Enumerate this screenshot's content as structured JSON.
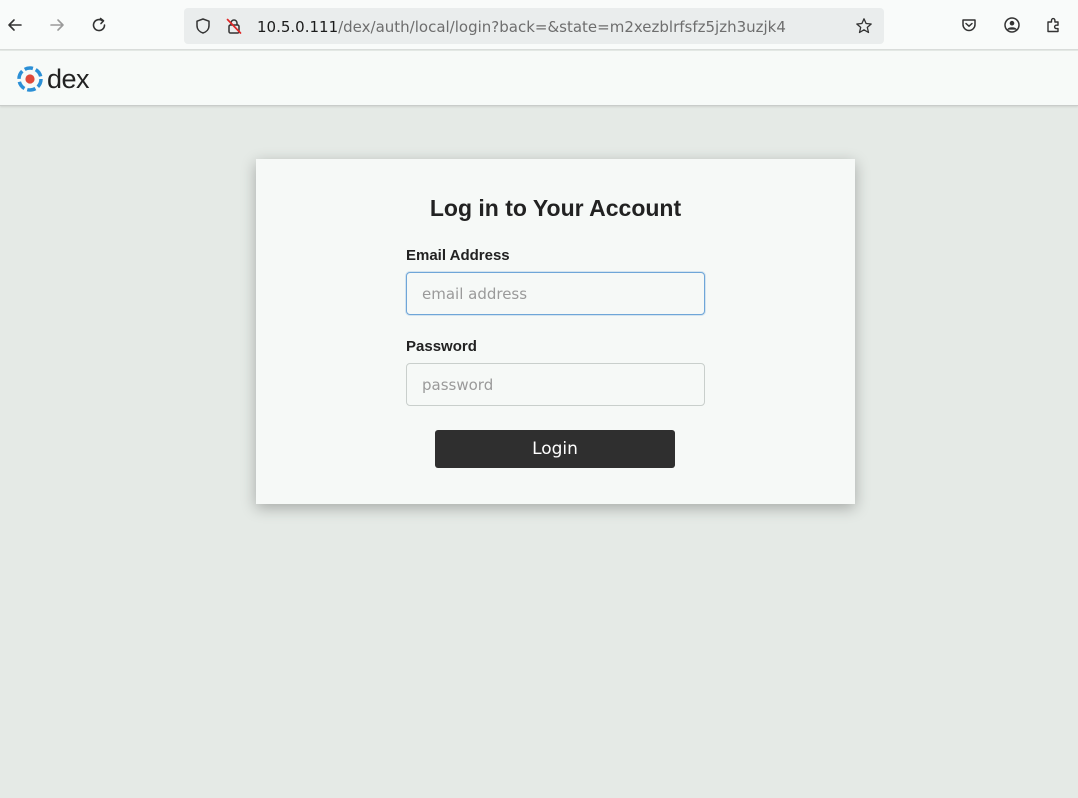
{
  "browser": {
    "url_host": "10.5.0.111",
    "url_path": "/dex/auth/local/login?back=&state=m2xezblrfsfz5jzh3uzjk4",
    "icons": {
      "back": "arrow-left-icon",
      "forward": "arrow-right-icon",
      "reload": "reload-icon",
      "shield": "shield-icon",
      "insecure": "insecure-lock-icon",
      "bookmark": "star-icon",
      "pocket": "pocket-icon",
      "account": "account-icon",
      "extensions": "extensions-icon"
    }
  },
  "header": {
    "logo_text": "dex"
  },
  "login": {
    "title": "Log in to Your Account",
    "email_label": "Email Address",
    "email_placeholder": "email address",
    "email_value": "",
    "password_label": "Password",
    "password_placeholder": "password",
    "password_value": "",
    "submit_label": "Login"
  },
  "colors": {
    "page_background": "#e5eae6",
    "card_background": "#f6f9f7",
    "button_background": "#2f2f2f",
    "focus_border": "#6fa6d8",
    "logo_blue": "#2b8fd6",
    "logo_red": "#e0493a"
  }
}
